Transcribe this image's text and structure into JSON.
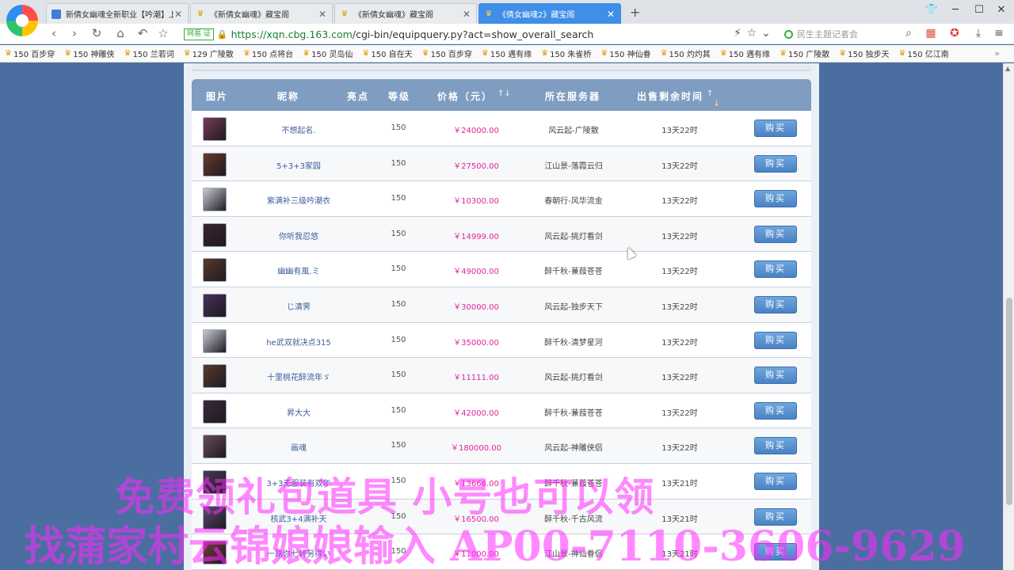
{
  "browser": {
    "tabs": [
      {
        "title": "新倩女幽魂全新职业【吟潮】上",
        "favicon": "doc-icon",
        "active": false
      },
      {
        "title": "《新倩女幽魂》藏宝阁",
        "favicon": "crown-icon",
        "active": false
      },
      {
        "title": "《新倩女幽魂》藏宝阁",
        "favicon": "crown-icon",
        "active": false
      },
      {
        "title": "《倩女幽魂2》藏宝阁",
        "favicon": "crown-icon",
        "active": true
      }
    ],
    "new_tab": "+",
    "url_badge": "网易 证",
    "url_host": "https://xqn.cbg.163.com",
    "url_path": "/cgi-bin/equipquery.py?act=show_overall_search",
    "search_placeholder": "民生主题记者会",
    "bookmarks": [
      "150 百步穿",
      "150 神雕侠",
      "150 兰若词",
      "129 广陵散",
      "150 点将台",
      "150 灵岛仙",
      "150 自在天",
      "150 百步穿",
      "150 遇有缘",
      "150 朱雀桥",
      "150 神仙眷",
      "150 灼灼其",
      "150 遇有缘",
      "150 广陵散",
      "150 独步天",
      "150 亿江南"
    ],
    "bookmarks_more": "»",
    "accent": "#3f8ee8"
  },
  "table": {
    "headers": {
      "image": "图片",
      "name": "昵称",
      "points": "亮点",
      "level": "等级",
      "price": "价格（元）",
      "server": "所在服务器",
      "time": "出售剩余时间"
    },
    "buy_label": "购买",
    "rows": [
      {
        "name": "不想起名.",
        "level": "150",
        "price": "￥24000.00",
        "server": "风云起-广陵散",
        "time": "13天22时",
        "avatar_color": "#7a3a55"
      },
      {
        "name": "5+3+3家园",
        "level": "150",
        "price": "￥27500.00",
        "server": "江山景-落霞云归",
        "time": "13天22时",
        "avatar_color": "#6a3a2a"
      },
      {
        "name": "紫满补三级吟潮衣",
        "level": "150",
        "price": "￥10300.00",
        "server": "春朝行-风华流金",
        "time": "13天22时",
        "avatar_color": "#c9ccd4"
      },
      {
        "name": "你听我忍悠",
        "level": "150",
        "price": "￥14999.00",
        "server": "风云起-挑灯看剑",
        "time": "13天22时",
        "avatar_color": "#3a2430"
      },
      {
        "name": "幽幽有風.ミ",
        "level": "150",
        "price": "￥49000.00",
        "server": "醉千秋-蒹葭苍苍",
        "time": "13天22时",
        "avatar_color": "#5a3a2a"
      },
      {
        "name": "じ清霁",
        "level": "150",
        "price": "￥30000.00",
        "server": "风云起-独步天下",
        "time": "13天22时",
        "avatar_color": "#4a2f5a"
      },
      {
        "name": "he武双就决点315",
        "level": "150",
        "price": "￥35000.00",
        "server": "醉千秋-清梦星河",
        "time": "13天22时",
        "avatar_color": "#c7cbd3"
      },
      {
        "name": "十里桃花醉流年ゞ",
        "level": "150",
        "price": "￥11111.00",
        "server": "风云起-挑灯看剑",
        "time": "13天22时",
        "avatar_color": "#5a3a28"
      },
      {
        "name": "昇大大",
        "level": "150",
        "price": "￥42000.00",
        "server": "醉千秋-蒹葭苍苍",
        "time": "13天22时",
        "avatar_color": "#3a2a35"
      },
      {
        "name": "画魂",
        "level": "150",
        "price": "￥180000.00",
        "server": "风云起-神雕侠侣",
        "time": "13天22时",
        "avatar_color": "#6a4a5a"
      },
      {
        "name": "3+3无服装有双年",
        "level": "150",
        "price": "￥13666.00",
        "server": "醉千秋-蒹葭苍苍",
        "time": "13天21时",
        "avatar_color": "#4a3a50"
      },
      {
        "name": "核武3+4满补天",
        "level": "150",
        "price": "￥16500.00",
        "server": "醉千秋-千古风流",
        "time": "13天21时",
        "avatar_color": "#5a4a6a"
      },
      {
        "name": "一路你七转另得い",
        "level": "150",
        "price": "￥11000.00",
        "server": "江山景-神仙眷侣",
        "time": "13天21时",
        "avatar_color": "#7a3a3a"
      }
    ]
  },
  "overlay": {
    "line1": "免费领礼包道具 小号也可以领",
    "line2": "找蒲家村云锦娘娘输入 AP00-7110-3606-9629"
  }
}
